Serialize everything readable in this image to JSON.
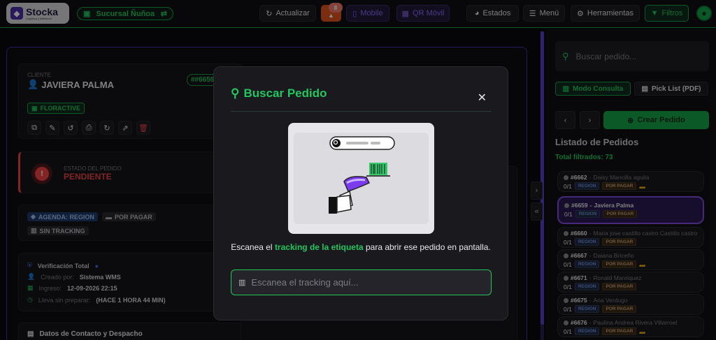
{
  "topbar": {
    "logo_name": "Stocka",
    "logo_sub": "Logistica y fulfillment",
    "branch": "Sucursal Ñuñoa",
    "actualizar": "Actualizar",
    "notif_count": "8",
    "mobile": "Mobile",
    "qr": "QR Móvil",
    "estados": "Estados",
    "menu": "Menú",
    "herramientas": "Herramientas",
    "filtros": "Filtros"
  },
  "detail": {
    "client_label": "CLIENTE",
    "client_name": "JAVIERA PALMA",
    "order_tag": "##6659",
    "store_tag": "FLORACTIVE",
    "status_label": "ESTADO DEL PEDIDO",
    "status_value": "PENDIENTE",
    "tag_agenda": "AGENDA: REGION",
    "tag_pagar": "POR PAGAR",
    "tag_tracking": "SIN TRACKING",
    "verif_title": "Verificación Total",
    "created_by_label": "Creado por:",
    "created_by": "Sistema WMS",
    "ingreso_label": "Ingreso:",
    "ingreso": "12-09-2026 22:15",
    "lleva_label": "Lleva sin preparar:",
    "lleva": "(HACE 1 HORA 44 MIN)",
    "contact_title": "Datos de Contacto y Despacho"
  },
  "sidebar": {
    "search_placeholder": "Buscar pedido...",
    "modo_consulta": "Modo Consulta",
    "pick_list": "Pick List (PDF)",
    "crear": "Crear Pedido",
    "list_title": "Listado de Pedidos",
    "total": "Total filtrados: 73",
    "orders": [
      {
        "id": "#6662",
        "name": "Daisy Mancilla aguila",
        "qty": "0/1",
        "region": "REGION",
        "pay": "POR PAGAR",
        "note": true
      },
      {
        "id": "#6659",
        "name": "Javiera Palma",
        "qty": "0/1",
        "region": "REGION",
        "pay": "POR PAGAR",
        "note": false
      },
      {
        "id": "#6660",
        "name": "Maria jose castillo castro Castillo castro",
        "qty": "0/1",
        "region": "REGION",
        "pay": "POR PAGAR",
        "note": false
      },
      {
        "id": "#6667",
        "name": "Daiana Briceño",
        "qty": "0/1",
        "region": "REGION",
        "pay": "POR PAGAR",
        "note": true
      },
      {
        "id": "#6671",
        "name": "Ronald Manriquez",
        "qty": "0/1",
        "region": "REGION",
        "pay": "POR PAGAR",
        "note": false
      },
      {
        "id": "#6675",
        "name": "Ana Verdugo",
        "qty": "0/1",
        "region": "REGION",
        "pay": "POR PAGAR",
        "note": false
      },
      {
        "id": "#6676",
        "name": "Paulina Andrea Rivera Villarroel",
        "qty": "0/1",
        "region": "REGION",
        "pay": "POR PAGAR",
        "note": true
      }
    ]
  },
  "modal": {
    "title": "Buscar Pedido",
    "text_before": "Escanea el ",
    "text_highlight": "tracking de la etiqueta",
    "text_after": " para abrir ese pedido en pantalla.",
    "input_placeholder": "Escanea el tracking aquí..."
  },
  "colors": {
    "accent_green": "#22c55e",
    "accent_purple": "#7c4ddb",
    "danger": "#ef4444"
  }
}
